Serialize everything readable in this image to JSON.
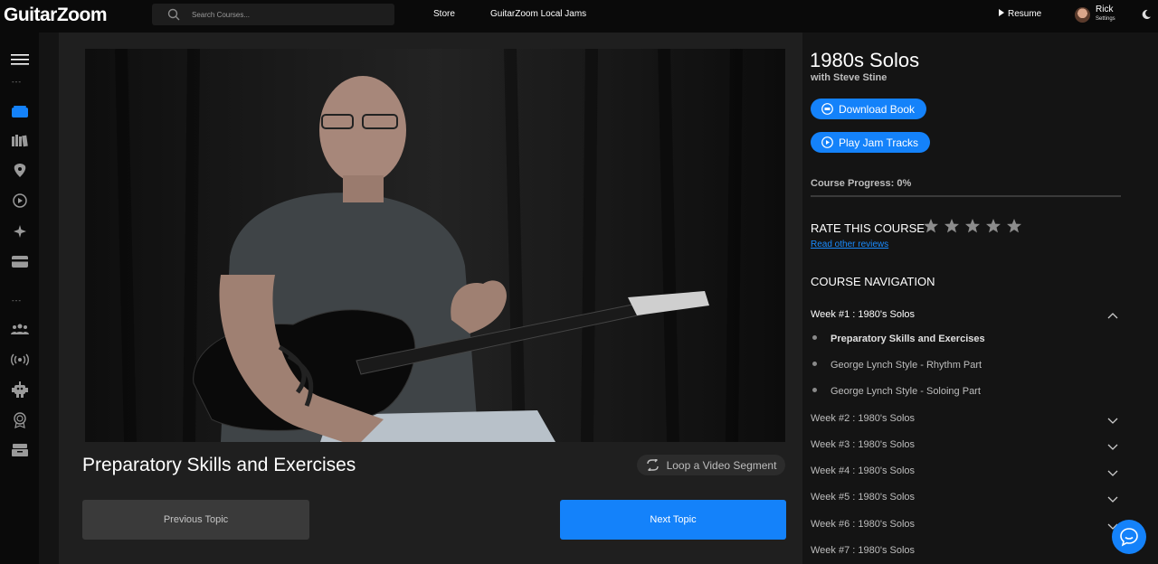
{
  "header": {
    "logo": "GuitarZoom",
    "search_placeholder": "Search Courses...",
    "nav": [
      "Store",
      "GuitarZoom Local Jams"
    ],
    "resume_label": "Resume",
    "user_name": "Rick",
    "user_sub": "Settings"
  },
  "sidebar": {
    "separator": "---",
    "icons": [
      "menu-icon",
      "courses-icon",
      "library-icon",
      "pick-icon",
      "play-icon",
      "plane-icon",
      "card-icon",
      "community-icon",
      "live-icon",
      "robot-icon",
      "badge-icon",
      "archive-icon"
    ]
  },
  "lesson": {
    "title": "Preparatory Skills and Exercises",
    "loop_label": "Loop a Video Segment",
    "prev_label": "Previous Topic",
    "next_label": "Next Topic"
  },
  "course": {
    "title": "1980s Solos",
    "instructor": "with Steve Stine",
    "download_label": "Download Book",
    "jam_label": "Play Jam Tracks",
    "progress_label": "Course Progress: 0%",
    "progress_value": 0,
    "rate_label": "RATE THIS COURSE",
    "rating": 0,
    "reviews_link": "Read other reviews",
    "nav_heading": "COURSE NAVIGATION",
    "weeks": [
      {
        "label": "Week #1 : 1980's Solos",
        "lessons": [
          "Preparatory Skills and Exercises",
          "George Lynch Style - Rhythm Part",
          "George Lynch Style - Soloing Part"
        ]
      },
      {
        "label": "Week #2 : 1980's Solos"
      },
      {
        "label": "Week #3 : 1980's Solos"
      },
      {
        "label": "Week #4 : 1980's Solos"
      },
      {
        "label": "Week #5 : 1980's Solos"
      },
      {
        "label": "Week #6 : 1980's Solos"
      },
      {
        "label": "Week #7 : 1980's Solos"
      }
    ]
  },
  "colors": {
    "accent": "#1482fa",
    "background": "#141414",
    "panel": "#1f1f1f",
    "topbar": "#0a0a0a"
  }
}
